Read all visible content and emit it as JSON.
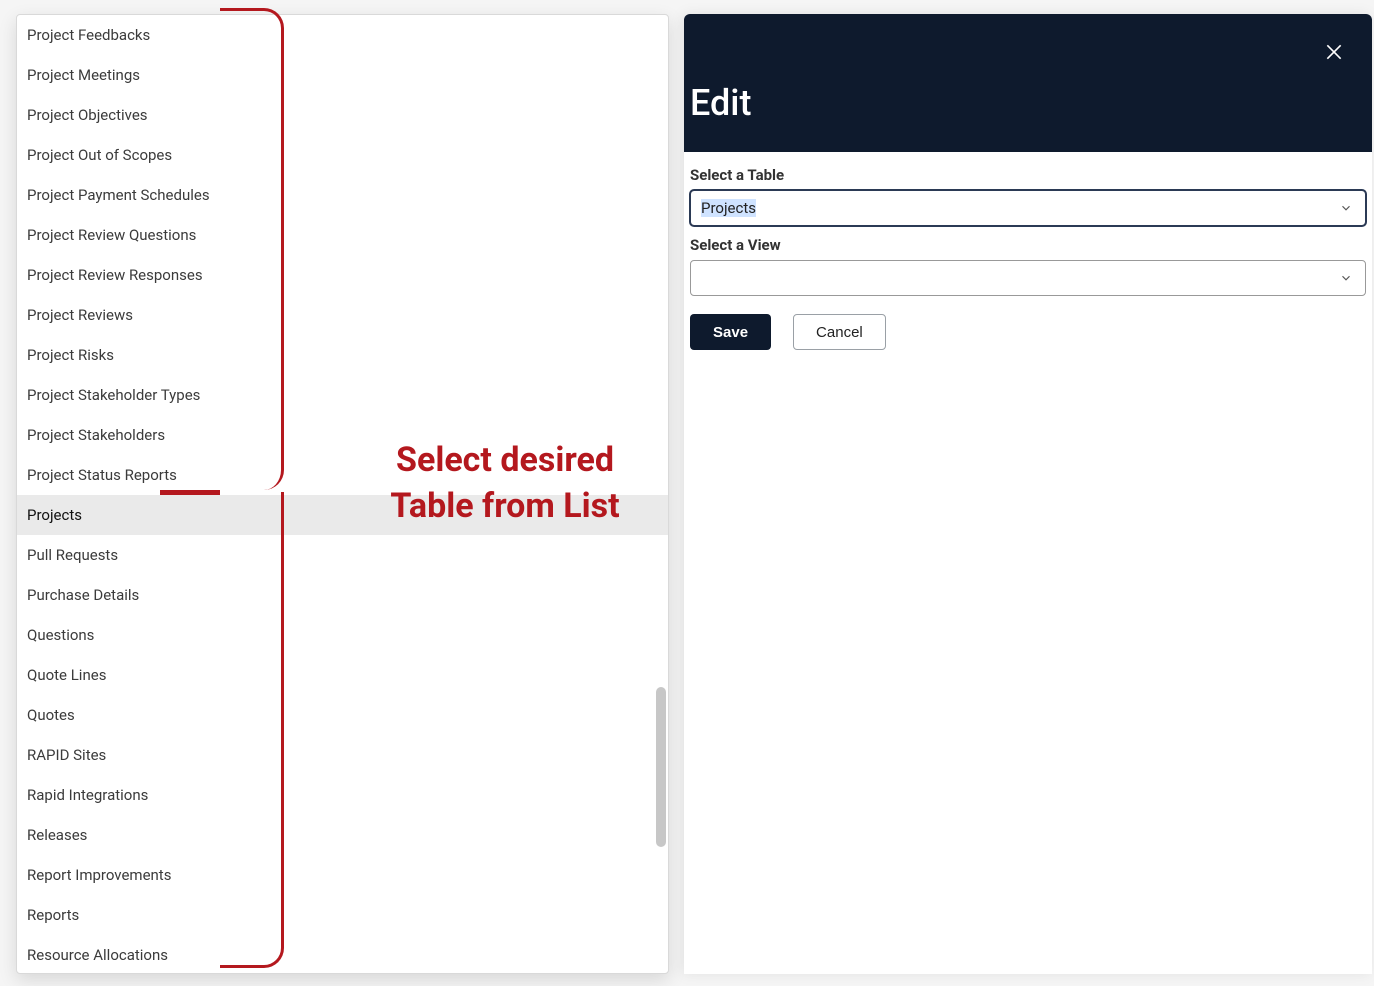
{
  "dropdown": {
    "selected_index": 12,
    "items": [
      "Project Feedbacks",
      "Project Meetings",
      "Project Objectives",
      "Project Out of Scopes",
      "Project Payment Schedules",
      "Project Review Questions",
      "Project Review Responses",
      "Project Reviews",
      "Project Risks",
      "Project Stakeholder Types",
      "Project Stakeholders",
      "Project Status Reports",
      "Projects",
      "Pull Requests",
      "Purchase Details",
      "Questions",
      "Quote Lines",
      "Quotes",
      "RAPID Sites",
      "Rapid Integrations",
      "Releases",
      "Report Improvements",
      "Reports",
      "Resource Allocations"
    ]
  },
  "annotation": {
    "text": "Select desired Table from List"
  },
  "edit_panel": {
    "title": "Edit",
    "table_label": "Select a Table",
    "table_value": "Projects",
    "view_label": "Select a View",
    "view_value": "",
    "save_label": "Save",
    "cancel_label": "Cancel"
  },
  "colors": {
    "header_bg": "#0e1a2d",
    "annotation_red": "#b4181e"
  }
}
